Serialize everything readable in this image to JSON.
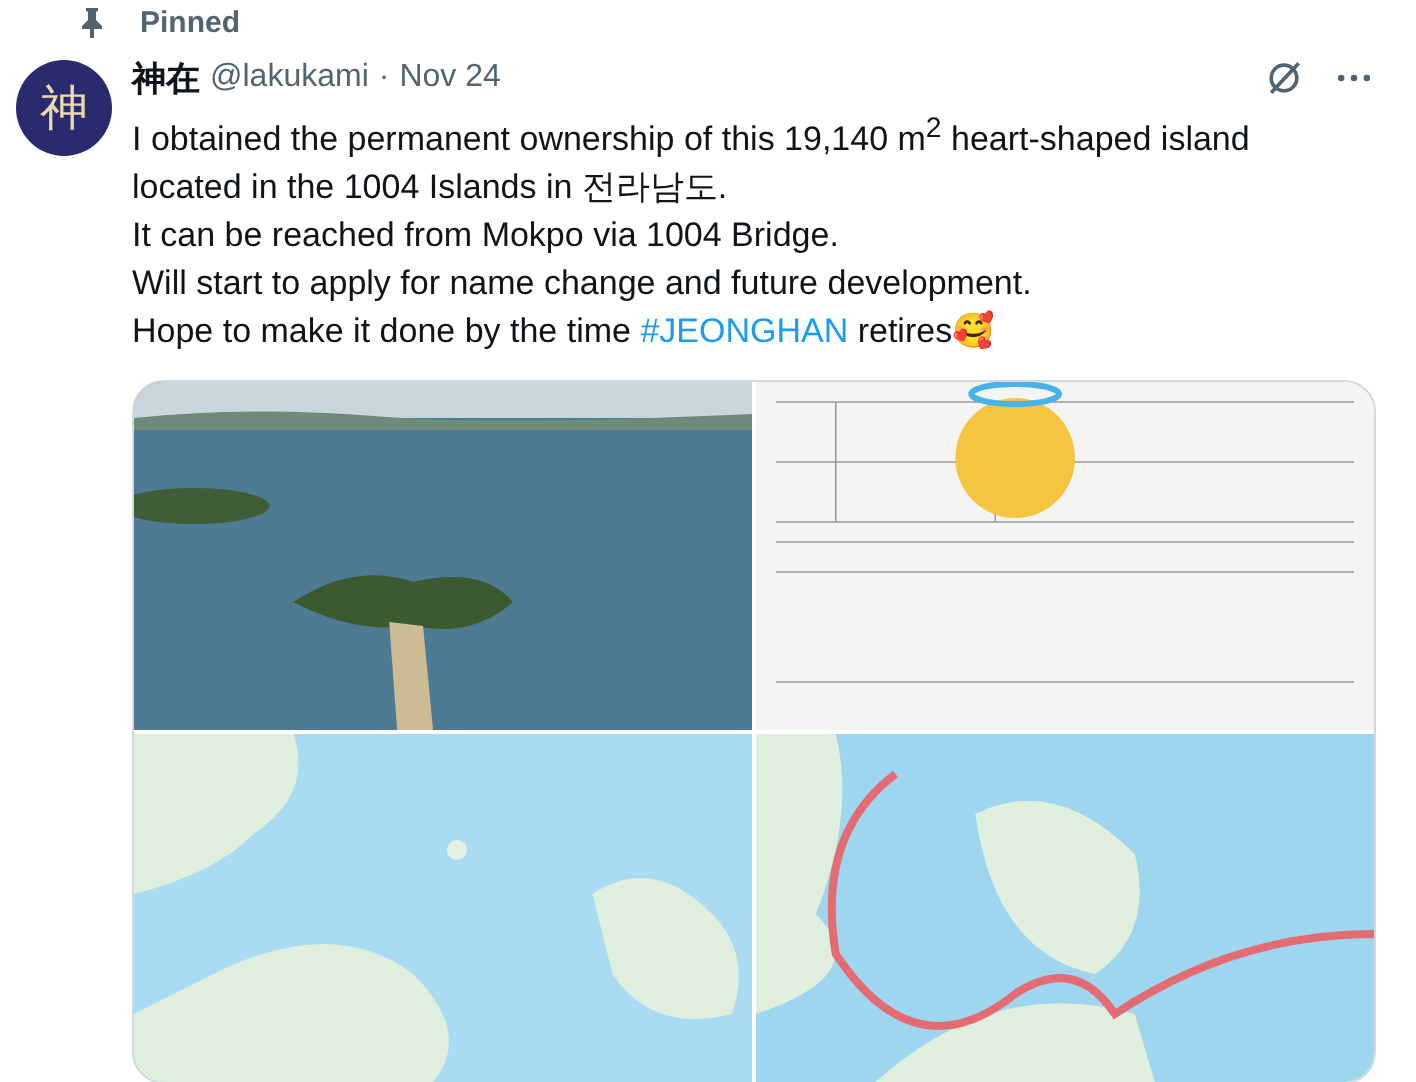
{
  "pinned_label": "Pinned",
  "author": {
    "avatar_text": "神",
    "name": "神在",
    "handle": "@lakukami",
    "separator": "·",
    "date": "Nov 24"
  },
  "body_lines": [
    {
      "parts": [
        {
          "kind": "text",
          "text": "I obtained the permanent ownership of this 19,140 m$^{2}$  heart-shaped island"
        }
      ]
    },
    {
      "parts": [
        {
          "kind": "text",
          "text": "located in the 1004 Islands in 전라남도."
        }
      ]
    },
    {
      "parts": [
        {
          "kind": "text",
          "text": "It can be reached from Mokpo via 1004 Bridge."
        }
      ]
    },
    {
      "parts": [
        {
          "kind": "text",
          "text": "Will start to apply for name change and future development."
        }
      ]
    },
    {
      "parts": [
        {
          "kind": "text",
          "text": "Hope to make it done by the time "
        },
        {
          "kind": "hashtag",
          "text": "#JEONGHAN"
        },
        {
          "kind": "text",
          "text": " retires🥰"
        }
      ]
    }
  ],
  "media": [
    {
      "kind": "island-photo"
    },
    {
      "kind": "document-photo"
    },
    {
      "kind": "map"
    },
    {
      "kind": "route-map"
    }
  ]
}
